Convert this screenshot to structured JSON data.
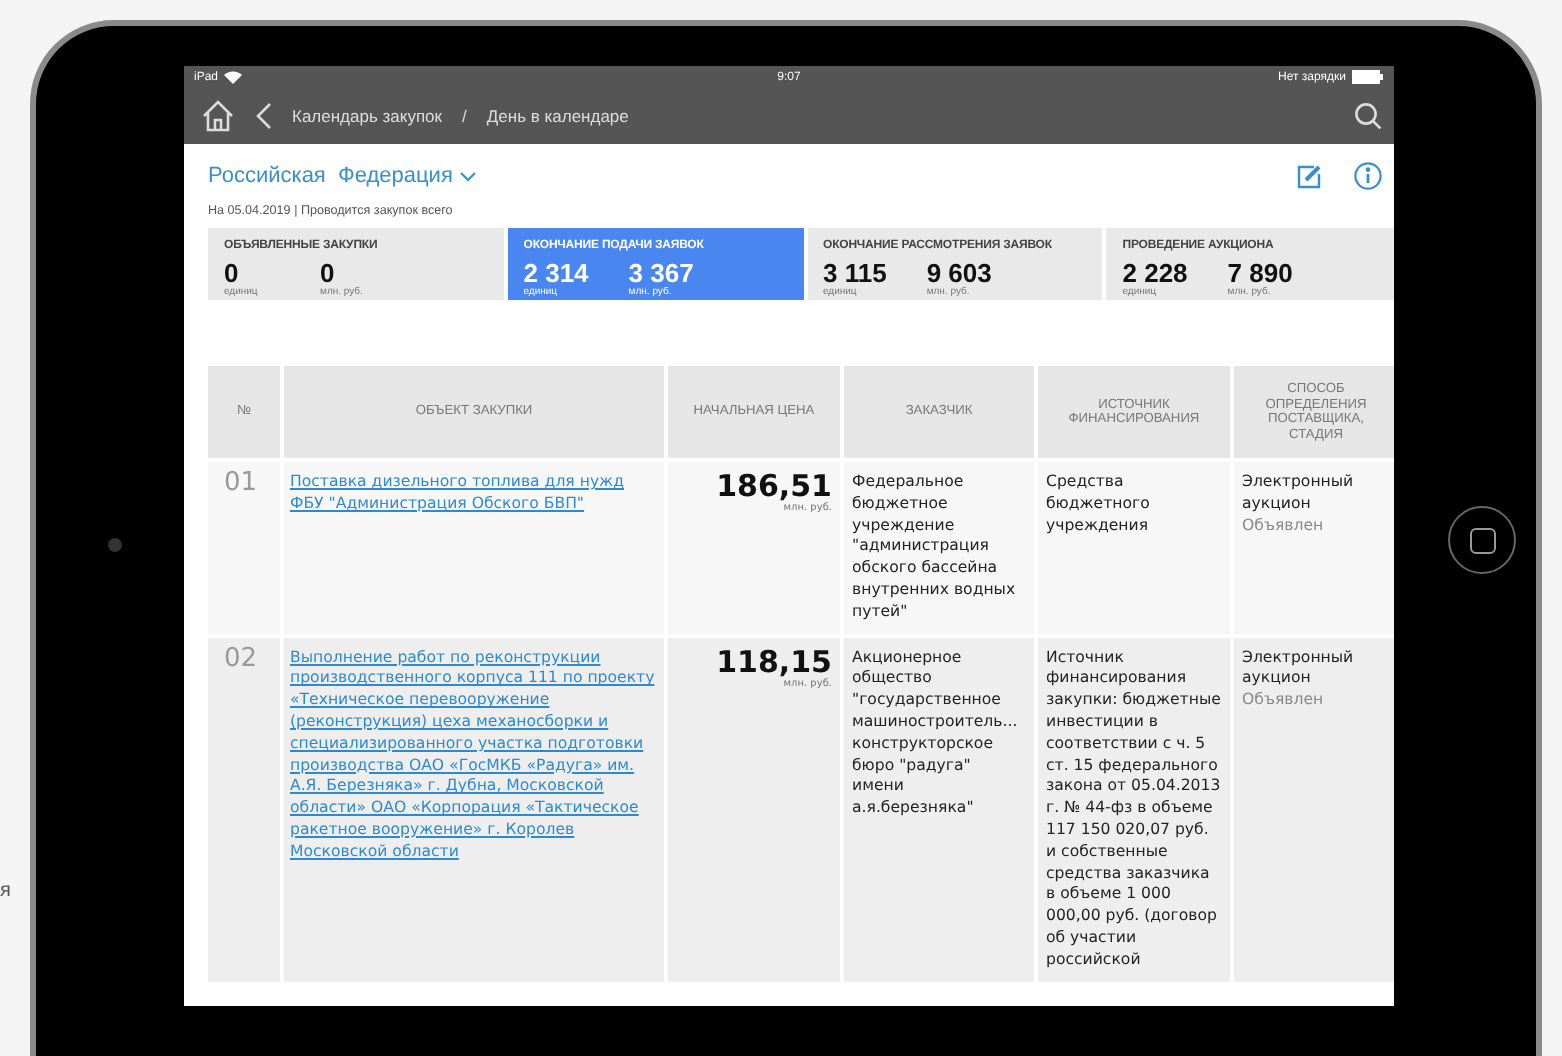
{
  "background_fragment": "я",
  "status_bar": {
    "device": "iPad",
    "time": "9:07",
    "battery_text": "Нет зарядки"
  },
  "nav": {
    "breadcrumbs": [
      "Календарь закупок",
      "День в календаре"
    ],
    "separator": "/"
  },
  "region": "Российская  Федерация",
  "subtitle": "На 05.04.2019 | Проводится закупок всего",
  "stats": [
    {
      "title": "ОБЪЯВЛЕННЫЕ ЗАКУПКИ",
      "selected": false,
      "count": "0",
      "count_unit": "единиц",
      "amount": "0",
      "amount_unit": "млн. руб."
    },
    {
      "title": "ОКОНЧАНИЕ ПОДАЧИ ЗАЯВОК",
      "selected": true,
      "count": "2 314",
      "count_unit": "единиц",
      "amount": "3 367",
      "amount_unit": "млн. руб."
    },
    {
      "title": "ОКОНЧАНИЕ РАССМОТРЕНИЯ ЗАЯВОК",
      "selected": false,
      "count": "3 115",
      "count_unit": "единиц",
      "amount": "9 603",
      "amount_unit": "млн. руб."
    },
    {
      "title": "ПРОВЕДЕНИЕ АУКЦИОНА",
      "selected": false,
      "count": "2 228",
      "count_unit": "единиц",
      "amount": "7 890",
      "amount_unit": "млн. руб."
    }
  ],
  "table": {
    "columns": [
      "№",
      "ОБЪЕКТ ЗАКУПКИ",
      "НАЧАЛЬНАЯ ЦЕНА",
      "ЗАКАЗЧИК",
      "ИСТОЧНИК ФИНАНСИРОВАНИЯ",
      "СПОСОБ ОПРЕДЕЛЕНИЯ ПОСТАВЩИКА, СТАДИЯ"
    ],
    "rows": [
      {
        "number": "01",
        "object": "Поставка дизельного топлива для нужд ФБУ \"Администрация Обского БВП\"",
        "price": "186,51",
        "price_unit": "млн. руб.",
        "customer": "Федеральное бюджетное учреждение \"администрация обского бассейна внутренних водных путей\"",
        "source": "Средства бюджетного учреждения",
        "method": "Электронный аукцион",
        "stage": "Объявлен"
      },
      {
        "number": "02",
        "object": "Выполнение работ по реконструкции производственного корпуса 111 по проекту «Техническое перевооружение (реконструкция) цеха механосборки и специализированного участка подготовки производства ОАО «ГосМКБ «Радуга» им. А.Я. Березняка» г. Дубна, Московской области» ОАО «Корпорация «Тактическое ракетное вооружение» г. Королев Московской области",
        "price": "118,15",
        "price_unit": "млн. руб.",
        "customer": "Акционерное общество \"государственное машиностроитель... конструкторское бюро \"радуга\" имени а.я.березняка\"",
        "source": "Источник финансирования закупки: бюджетные инвестиции в соответствии с ч. 5 ст. 15 федерального закона от 05.04.2013 г. № 44-фз в объеме 117 150 020,07 руб. и собственные средства заказчика в объеме 1 000 000,00 руб. (договор об участии российской",
        "method": "Электронный аукцион",
        "stage": "Объявлен"
      }
    ]
  }
}
